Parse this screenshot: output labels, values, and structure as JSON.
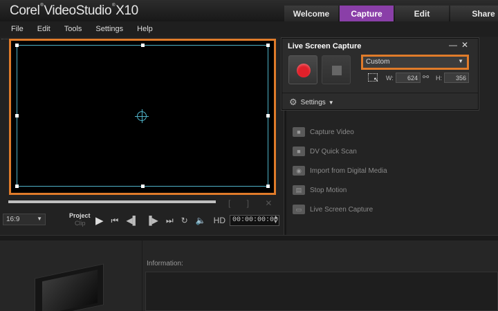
{
  "app": {
    "brand_corel": "Corel",
    "brand_reg": "®",
    "brand_product": "VideoStudio",
    "brand_version": "X10"
  },
  "tabs": [
    "Welcome",
    "Capture",
    "Edit",
    "Share"
  ],
  "active_tab": "Capture",
  "accent_color": "#8a3fa8",
  "highlight_color": "#e07b2a",
  "selection_color": "#4fb3c9",
  "menu": [
    "File",
    "Edit",
    "Tools",
    "Settings",
    "Help"
  ],
  "player": {
    "aspect": "16:9",
    "mode_label": "Project",
    "mode_label2": "Clip",
    "hd_label": "HD",
    "timecode": "00:00:00:00"
  },
  "live_capture": {
    "title": "Live Screen Capture",
    "preset": "Custom",
    "width_label": "W:",
    "width_value": "624",
    "height_label": "H:",
    "height_value": "356",
    "settings_label": "Settings"
  },
  "capture_options": [
    {
      "label": "Capture Video",
      "icon": "video-camera-icon"
    },
    {
      "label": "DV Quick Scan",
      "icon": "dv-scan-icon"
    },
    {
      "label": "Import from Digital Media",
      "icon": "disc-import-icon"
    },
    {
      "label": "Stop Motion",
      "icon": "stop-motion-icon"
    },
    {
      "label": "Live Screen Capture",
      "icon": "screen-capture-icon"
    }
  ],
  "information": {
    "label": "Information:"
  }
}
